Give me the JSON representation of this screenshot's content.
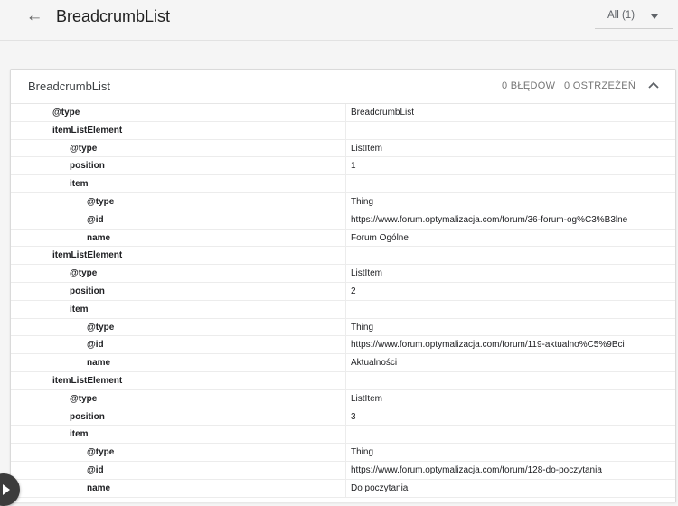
{
  "header": {
    "title": "BreadcrumbList",
    "filter_value": "All (1)"
  },
  "card": {
    "title": "BreadcrumbList",
    "errors": "0 BŁĘDÓW",
    "warnings": "0 OSTRZEŻEŃ"
  },
  "rows": [
    {
      "key": "@type",
      "value": "BreadcrumbList",
      "level": 0
    },
    {
      "key": "itemListElement",
      "value": "",
      "level": 0
    },
    {
      "key": "@type",
      "value": "ListItem",
      "level": 1
    },
    {
      "key": "position",
      "value": "1",
      "level": 1
    },
    {
      "key": "item",
      "value": "",
      "level": 1
    },
    {
      "key": "@type",
      "value": "Thing",
      "level": 2
    },
    {
      "key": "@id",
      "value": "https://www.forum.optymalizacja.com/forum/36-forum-og%C3%B3lne",
      "level": 2
    },
    {
      "key": "name",
      "value": "Forum Ogólne",
      "level": 2
    },
    {
      "key": "itemListElement",
      "value": "",
      "level": 0
    },
    {
      "key": "@type",
      "value": "ListItem",
      "level": 1
    },
    {
      "key": "position",
      "value": "2",
      "level": 1
    },
    {
      "key": "item",
      "value": "",
      "level": 1
    },
    {
      "key": "@type",
      "value": "Thing",
      "level": 2
    },
    {
      "key": "@id",
      "value": "https://www.forum.optymalizacja.com/forum/119-aktualno%C5%9Bci",
      "level": 2
    },
    {
      "key": "name",
      "value": "Aktualności",
      "level": 2
    },
    {
      "key": "itemListElement",
      "value": "",
      "level": 0
    },
    {
      "key": "@type",
      "value": "ListItem",
      "level": 1
    },
    {
      "key": "position",
      "value": "3",
      "level": 1
    },
    {
      "key": "item",
      "value": "",
      "level": 1
    },
    {
      "key": "@type",
      "value": "Thing",
      "level": 2
    },
    {
      "key": "@id",
      "value": "https://www.forum.optymalizacja.com/forum/128-do-poczytania",
      "level": 2
    },
    {
      "key": "name",
      "value": "Do poczytania",
      "level": 2
    }
  ],
  "icons": {
    "back": "arrow-left-icon",
    "dropdown": "caret-down-icon",
    "collapse": "chevron-up-icon",
    "fab": "play-icon"
  }
}
